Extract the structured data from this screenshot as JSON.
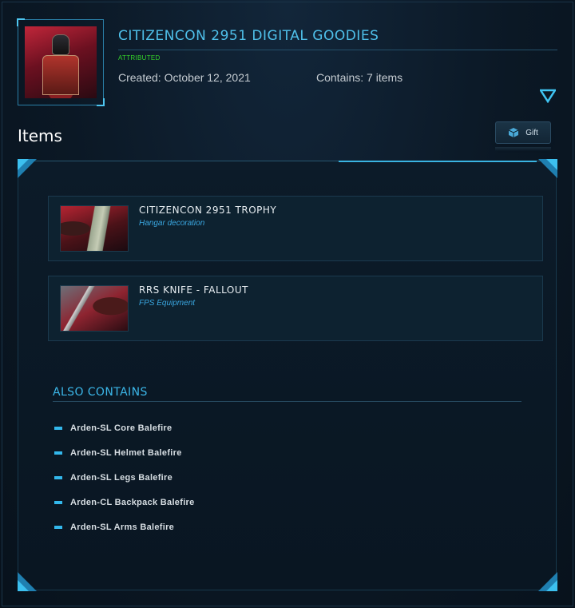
{
  "pledge": {
    "title": "CITIZENCON 2951 DIGITAL GOODIES",
    "status": "ATTRIBUTED",
    "created": "Created: October 12, 2021",
    "contains": "Contains: 7 items"
  },
  "items_section": {
    "heading": "Items",
    "gift_label": "Gift",
    "items": [
      {
        "name": "CITIZENCON 2951 TROPHY",
        "type": "Hangar decoration"
      },
      {
        "name": "RRS KNIFE - FALLOUT",
        "type": "FPS Equipment"
      }
    ]
  },
  "also_contains": {
    "heading": "ALSO CONTAINS",
    "items": [
      "Arden-SL Core Balefire",
      "Arden-SL Helmet Balefire",
      "Arden-SL Legs Balefire",
      "Arden-CL Backpack Balefire",
      "Arden-SL Arms Balefire"
    ]
  },
  "icons": {
    "collapse": "triangle-down-icon",
    "gift": "gift-cube-icon"
  },
  "colors": {
    "accent": "#4fc0ea",
    "status_green": "#35d42a",
    "background": "#0a1622"
  }
}
